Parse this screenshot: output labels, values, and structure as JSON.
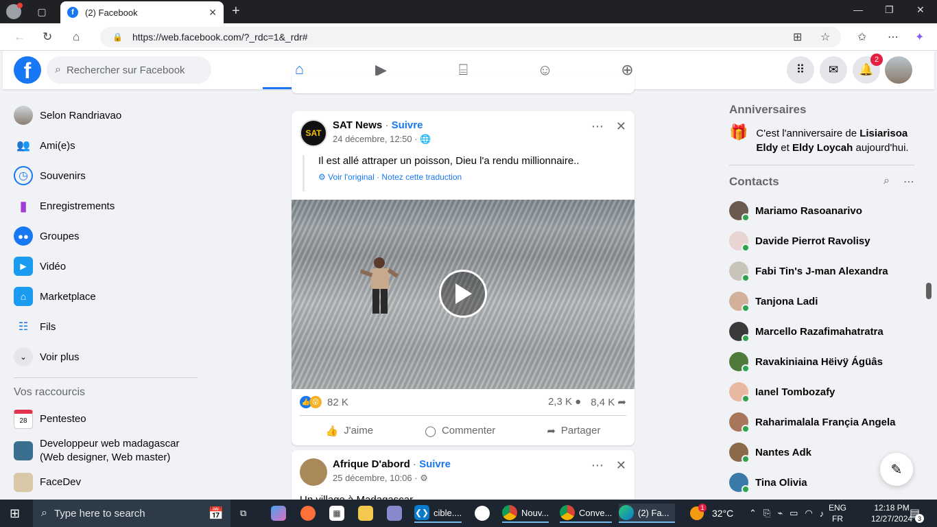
{
  "browser": {
    "tab_title": "(2) Facebook",
    "url": "https://web.facebook.com/?_rdc=1&_rdr#"
  },
  "header": {
    "search_placeholder": "Rechercher sur Facebook",
    "notification_count": "2",
    "nav_tabs": [
      "home-icon",
      "video-icon",
      "marketplace-icon",
      "groups-icon",
      "gaming-icon"
    ],
    "active_tab": "home"
  },
  "sidebar": {
    "items": [
      {
        "label": "Selon Randriavao",
        "icon": "profile-avatar"
      },
      {
        "label": "Ami(e)s",
        "icon": "friends-icon"
      },
      {
        "label": "Souvenirs",
        "icon": "memories-icon"
      },
      {
        "label": "Enregistrements",
        "icon": "bookmark-icon"
      },
      {
        "label": "Groupes",
        "icon": "groups-icon"
      },
      {
        "label": "Vidéo",
        "icon": "video-icon"
      },
      {
        "label": "Marketplace",
        "icon": "marketplace-icon"
      },
      {
        "label": "Fils",
        "icon": "feeds-icon"
      },
      {
        "label": "Voir plus",
        "icon": "chevron-down-icon"
      }
    ],
    "shortcuts_title": "Vos raccourcis",
    "shortcuts": [
      {
        "label": "Pentesteo",
        "icon": "calendar-28-icon",
        "badge": "28"
      },
      {
        "label": "Developpeur web madagascar (Web designer, Web master)",
        "icon": "group-avatar"
      },
      {
        "label": "FaceDev",
        "icon": "group-avatar"
      }
    ]
  },
  "feed": {
    "post1": {
      "page": "SAT News",
      "follow": "Suivre",
      "separator": " · ",
      "date": "24 décembre, 12:50 ·",
      "text": "Il est allé attraper un poisson, Dieu l'a rendu millionnaire..",
      "translate_links": "Voir l'original · Notez cette traduction",
      "reactions": "82 K",
      "comments": "2,3 K",
      "shares": "8,4 K",
      "actions": {
        "like": "J'aime",
        "comment": "Commenter",
        "share": "Partager"
      },
      "avatar_text": "SAT"
    },
    "post2": {
      "page": "Afrique D'abord",
      "follow": "Suivre",
      "separator": " · ",
      "date": "25 décembre, 10:06 ·",
      "text": "Un village à Madagascar"
    }
  },
  "right": {
    "birthdays_title": "Anniversaires",
    "birthday_prefix": "C'est l'anniversaire de ",
    "birthday_name1": "Lisiarisoa Eldy",
    "birthday_and": " et ",
    "birthday_name2": "Eldy Loycah",
    "birthday_suffix": " aujourd'hui.",
    "contacts_title": "Contacts",
    "contacts": [
      "Mariamo Rasoanarivo",
      "Davide Pierrot Ravolisy",
      "Fabi Tin's J-man Alexandra",
      "Tanjona Ladi",
      "Marcello Razafimahatratra",
      "Ravakiniaina Hëivÿ Ágüâs",
      "Ianel Tombozafy",
      "Raharimalala Françia Angela",
      "Nantes Adk",
      "Tina Olivia"
    ]
  },
  "taskbar": {
    "search_placeholder": "Type here to search",
    "apps": [
      {
        "label": "cible....",
        "icon": "vscode-icon"
      },
      {
        "label": "Nouv...",
        "icon": "chrome-icon"
      },
      {
        "label": "Conve...",
        "icon": "chrome-icon"
      },
      {
        "label": "(2) Fa...",
        "icon": "edge-icon"
      }
    ],
    "weather": "32°C",
    "lang_top": "ENG",
    "lang_bottom": "FR",
    "time": "12:18 PM",
    "date": "12/27/2024",
    "notifications": "3",
    "weather_badge": "1"
  },
  "colors": {
    "fb_blue": "#1877f2",
    "taskbar": "#1c2530",
    "badge_red": "#e41e3f"
  }
}
